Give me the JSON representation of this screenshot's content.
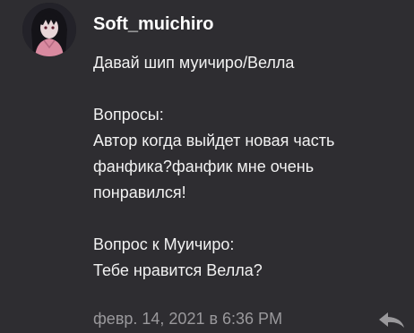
{
  "comment": {
    "author": "Soft_muichiro",
    "lines": [
      "Давай шип муичиро/Велла",
      "",
      "Вопросы:",
      "Автор когда выйдет новая часть",
      "фанфика?фанфик мне очень",
      "понравился!",
      "",
      "Вопрос к Муичиро:",
      "Тебе нравится Велла?"
    ],
    "timestamp": "февр. 14, 2021 в 6:36 PM",
    "avatar_icon": "user-avatar",
    "reply_icon": "reply-arrow-icon"
  },
  "colors": {
    "background": "#2e2d31",
    "text": "#f2f2f2",
    "username": "#ffffff",
    "timestamp": "#9a999c",
    "reply_icon": "#9a999c"
  }
}
